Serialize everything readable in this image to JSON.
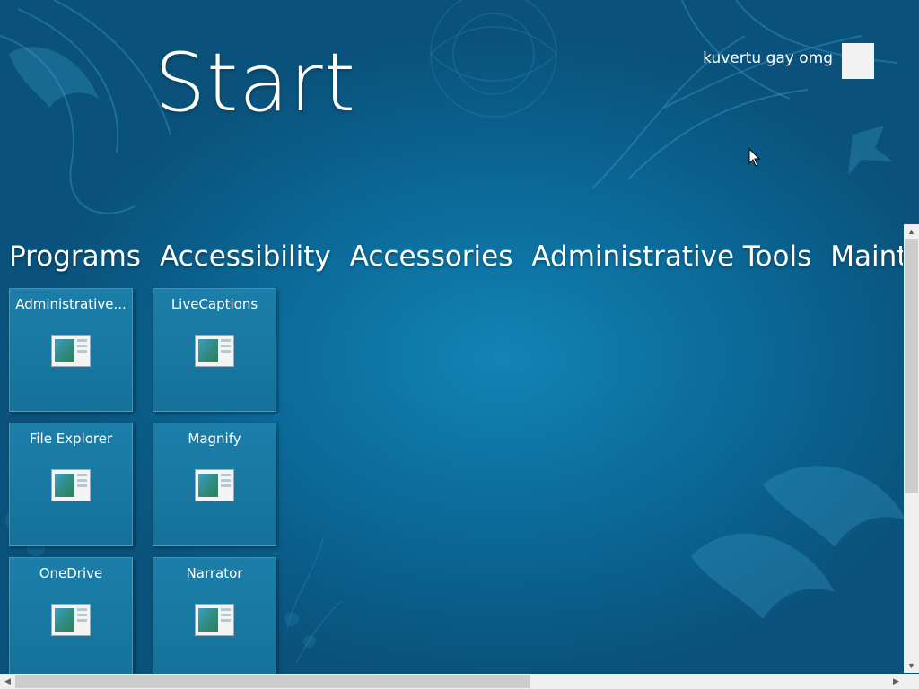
{
  "header": {
    "title": "Start",
    "user_name": "kuvertu gay omg"
  },
  "groups": [
    {
      "label": "Programs"
    },
    {
      "label": "Accessibility"
    },
    {
      "label": "Accessories"
    },
    {
      "label": "Administrative Tools"
    },
    {
      "label": "Maintenar"
    }
  ],
  "tiles": [
    {
      "label": "Administrative...",
      "icon": "application-window-icon"
    },
    {
      "label": "LiveCaptions",
      "icon": "application-window-icon"
    },
    {
      "label": "File Explorer",
      "icon": "application-window-icon"
    },
    {
      "label": "Magnify",
      "icon": "application-window-icon"
    },
    {
      "label": "OneDrive",
      "icon": "application-window-icon"
    },
    {
      "label": "Narrator",
      "icon": "application-window-icon"
    }
  ],
  "colors": {
    "background": "#0c6d9d",
    "tile": "#1a7aa4",
    "text": "#ffffff"
  }
}
